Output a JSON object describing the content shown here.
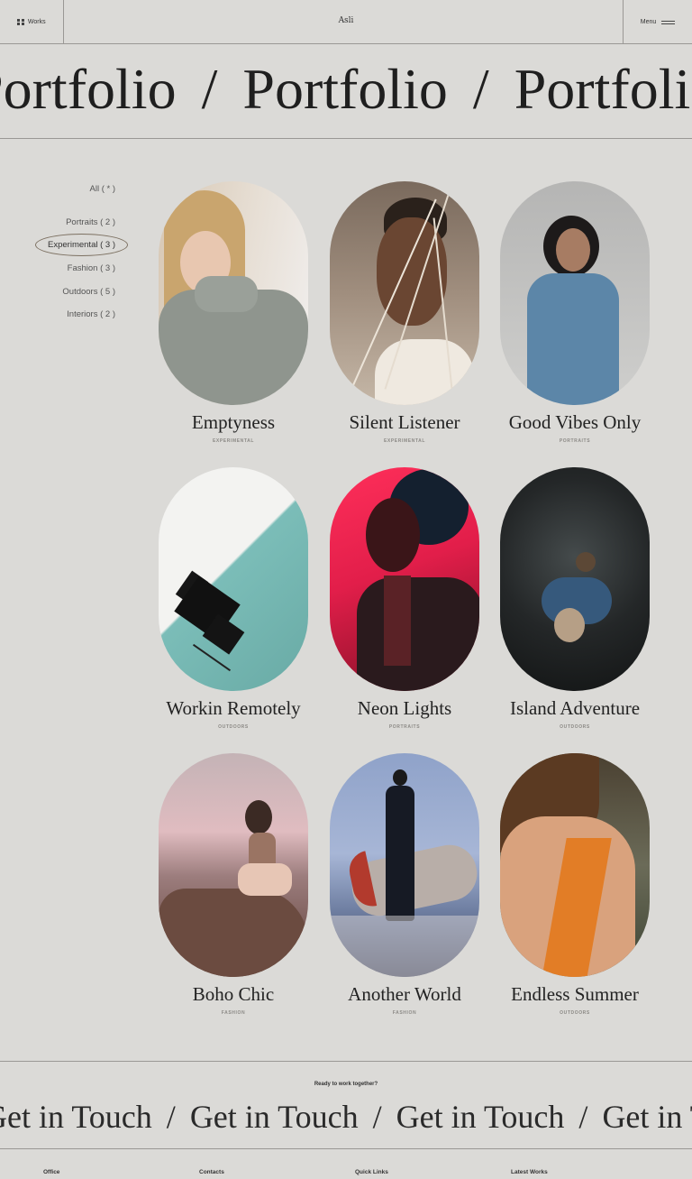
{
  "header": {
    "works_label": "Works",
    "brand": "Asli",
    "menu_label": "Menu"
  },
  "hero_marquee": {
    "word": "Portfolio",
    "separator": "/"
  },
  "filters": [
    {
      "label": "All ( * )"
    },
    {
      "label": "Portraits ( 2 )"
    },
    {
      "label": "Experimental ( 3 )",
      "active": true
    },
    {
      "label": "Fashion ( 3 )"
    },
    {
      "label": "Outdoors ( 5 )"
    },
    {
      "label": "Interiors ( 2 )"
    }
  ],
  "works": [
    {
      "title": "Emptyness",
      "category": "EXPERIMENTAL"
    },
    {
      "title": "Silent Listener",
      "category": "EXPERIMENTAL"
    },
    {
      "title": "Good Vibes Only",
      "category": "PORTRAITS"
    },
    {
      "title": "Workin Remotely",
      "category": "OUTDOORS"
    },
    {
      "title": "Neon Lights",
      "category": "PORTRAITS"
    },
    {
      "title": "Island Adventure",
      "category": "OUTDOORS"
    },
    {
      "title": "Boho Chic",
      "category": "FASHION"
    },
    {
      "title": "Another World",
      "category": "FASHION"
    },
    {
      "title": "Endless Summer",
      "category": "OUTDOORS"
    }
  ],
  "cta": {
    "kicker": "Ready to work together?",
    "phrase": "Get in Touch",
    "separator": "/"
  },
  "footer": {
    "office": "Office",
    "contacts": "Contacts",
    "quick_links": "Quick Links",
    "latest_works": "Latest Works"
  }
}
